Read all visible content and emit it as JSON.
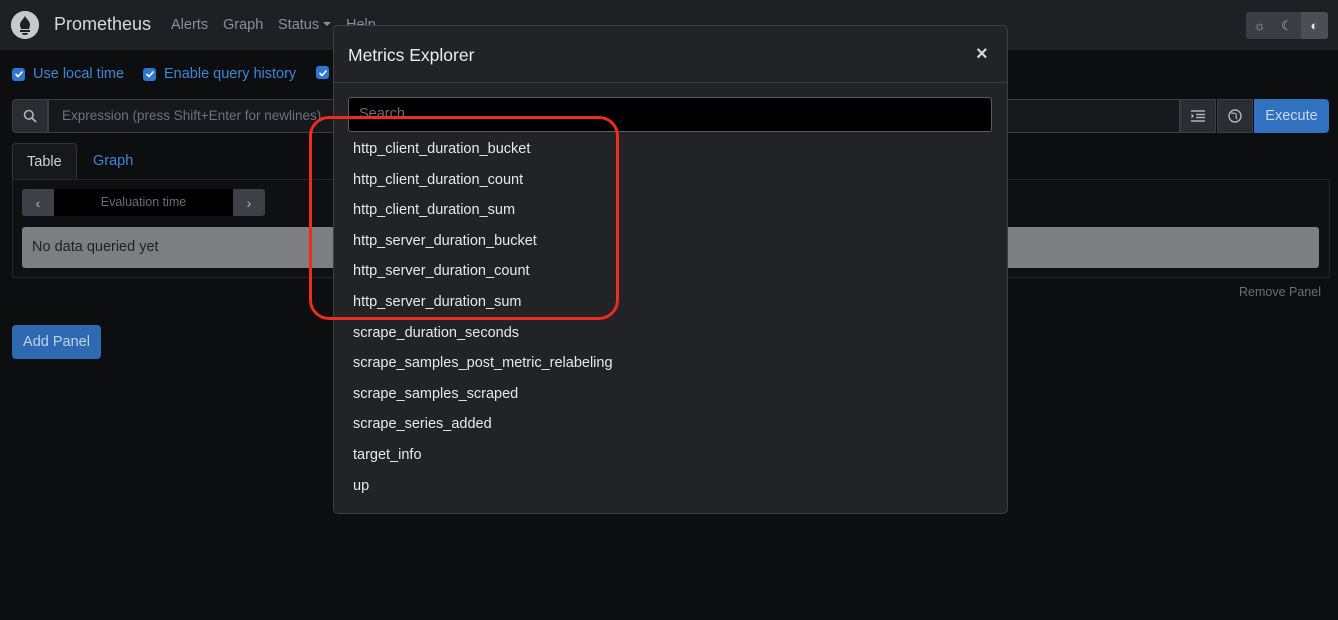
{
  "navbar": {
    "brand": "Prometheus",
    "links": [
      "Alerts",
      "Graph",
      "Status",
      "Help"
    ],
    "theme_buttons": [
      "light-theme",
      "dark-theme",
      "auto-theme"
    ]
  },
  "options": {
    "use_local_time": "Use local time",
    "enable_query_history": "Enable query history"
  },
  "expression": {
    "placeholder": "Expression (press Shift+Enter for newlines)",
    "execute_label": "Execute"
  },
  "panel": {
    "tabs": [
      "Table",
      "Graph"
    ],
    "eval_time_placeholder": "Evaluation time",
    "no_data": "No data queried yet",
    "remove_panel": "Remove Panel",
    "add_panel": "Add Panel"
  },
  "modal": {
    "title": "Metrics Explorer",
    "close_glyph": "×",
    "search_placeholder": "Search",
    "metrics": [
      "http_client_duration_bucket",
      "http_client_duration_count",
      "http_client_duration_sum",
      "http_server_duration_bucket",
      "http_server_duration_count",
      "http_server_duration_sum",
      "scrape_duration_seconds",
      "scrape_samples_post_metric_relabeling",
      "scrape_samples_scraped",
      "scrape_series_added",
      "target_info",
      "up"
    ]
  },
  "colors": {
    "accent": "#3172c0",
    "highlight": "#ec2c1f"
  }
}
